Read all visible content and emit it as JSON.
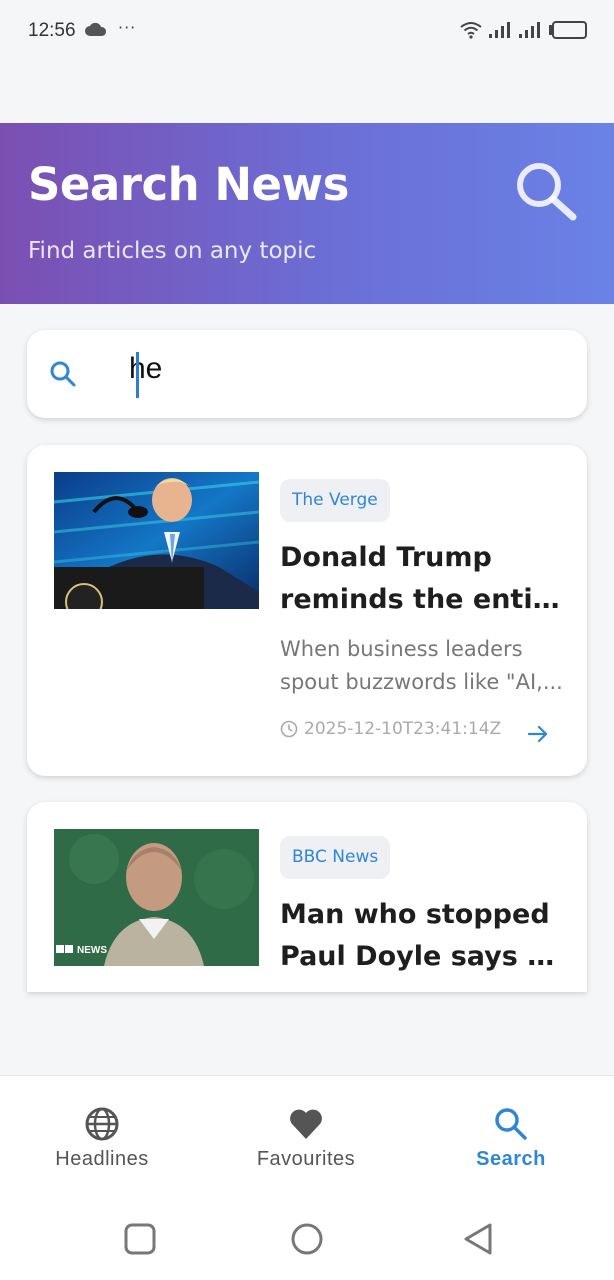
{
  "status": {
    "time": "12:56",
    "dots": "···",
    "battery_level": 0.0
  },
  "header": {
    "title": "Search News",
    "subtitle": "Find articles on any topic",
    "icon": "search-icon"
  },
  "search": {
    "value": "he"
  },
  "articles": [
    {
      "source": "The Verge",
      "title_line1": "Donald Trump",
      "title_line2": "reminds the entire ...",
      "desc_line1": "When business leaders",
      "desc_line2": "spout buzzwords like \"AI,...",
      "published": "2025-12-10T23:41:14Z"
    },
    {
      "source": "BBC News",
      "title_line1": "Man who stopped",
      "title_line2": "Paul Doyle says he ...",
      "thumb_label": "NEWS"
    }
  ],
  "nav": {
    "items": [
      {
        "label": "Headlines",
        "icon": "globe-icon"
      },
      {
        "label": "Favourites",
        "icon": "heart-icon"
      },
      {
        "label": "Search",
        "icon": "search-icon",
        "active": true
      }
    ]
  },
  "colors": {
    "accent": "#2f86d6",
    "gradient_start": "#7b4fb2",
    "gradient_end": "#6a82e6"
  }
}
